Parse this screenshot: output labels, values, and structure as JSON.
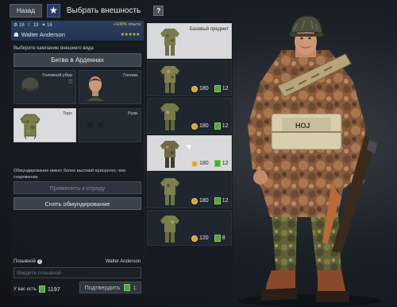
{
  "topbar": {
    "back": "Назад",
    "title": "Выбрать внешность",
    "help": "?"
  },
  "soldier": {
    "stat1": "16",
    "stat2": "19",
    "stat3": "16",
    "exp_bonus": "+100% опыта",
    "name": "Walter Anderson",
    "stars": "★★★★★"
  },
  "campaign": {
    "label": "Выберите кампанию внешнего вида",
    "selected": "Битва в Арденнах"
  },
  "slots": [
    {
      "label": "Головной убор",
      "icon": "helmet"
    },
    {
      "label": "Голова",
      "icon": "head"
    },
    {
      "label": "Торс",
      "icon": "torso"
    },
    {
      "label": "Руки",
      "icon": "hands"
    }
  ],
  "note": "Обмундирование имеет более высокий приоритет, чем снаряжение",
  "apply_label": "Применить к отряду",
  "remove_label": "Снять обмундирование",
  "callsign": {
    "label": "Позывной",
    "name": "Walter Anderson",
    "placeholder": "Введите позывной"
  },
  "balance": {
    "label": "У вас есть",
    "value": "1197"
  },
  "confirm": {
    "label": "Подтвердить",
    "count": "1"
  },
  "items": [
    {
      "base_label": "Базовый предмет",
      "selected": true
    },
    {
      "price": "180",
      "tickets": "12"
    },
    {
      "price": "180",
      "tickets": "12"
    },
    {
      "price": "180",
      "tickets": "12",
      "selected": true
    },
    {
      "price": "180",
      "tickets": "12"
    },
    {
      "price": "120",
      "tickets": "8"
    }
  ]
}
